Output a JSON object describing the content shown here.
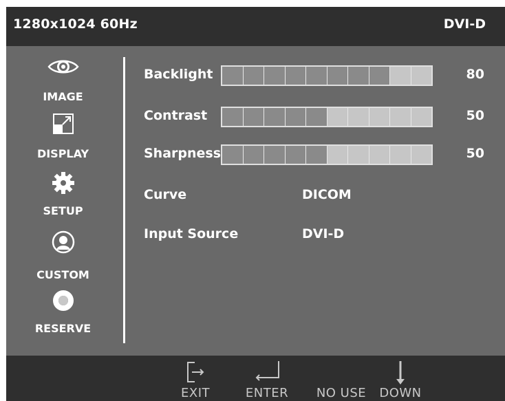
{
  "header": {
    "resolution": "1280x1024 60Hz",
    "source": "DVI-D"
  },
  "sidebar": {
    "items": [
      {
        "label": "IMAGE",
        "icon": "eye-icon"
      },
      {
        "label": "DISPLAY",
        "icon": "resize-icon"
      },
      {
        "label": "SETUP",
        "icon": "gear-icon"
      },
      {
        "label": "CUSTOM",
        "icon": "user-icon"
      },
      {
        "label": "RESERVE",
        "icon": "ring-icon"
      }
    ]
  },
  "settings": {
    "backlight": {
      "label": "Backlight",
      "value": "80",
      "level": 0.8
    },
    "contrast": {
      "label": "Contrast",
      "value": "50",
      "level": 0.5
    },
    "sharpness": {
      "label": "Sharpness",
      "value": "50",
      "level": 0.5
    },
    "curve": {
      "label": "Curve",
      "value": "DICOM"
    },
    "input_source": {
      "label": "Input Source",
      "value": "DVI-D"
    }
  },
  "footer": {
    "exit": "EXIT",
    "enter": "ENTER",
    "no_use": "NO USE",
    "down": "DOWN"
  },
  "colors": {
    "panel": "#696969",
    "bars_dark": "#2f2f2f",
    "segment_on": "#8a8a8a",
    "segment_off": "#c6c6c6"
  }
}
